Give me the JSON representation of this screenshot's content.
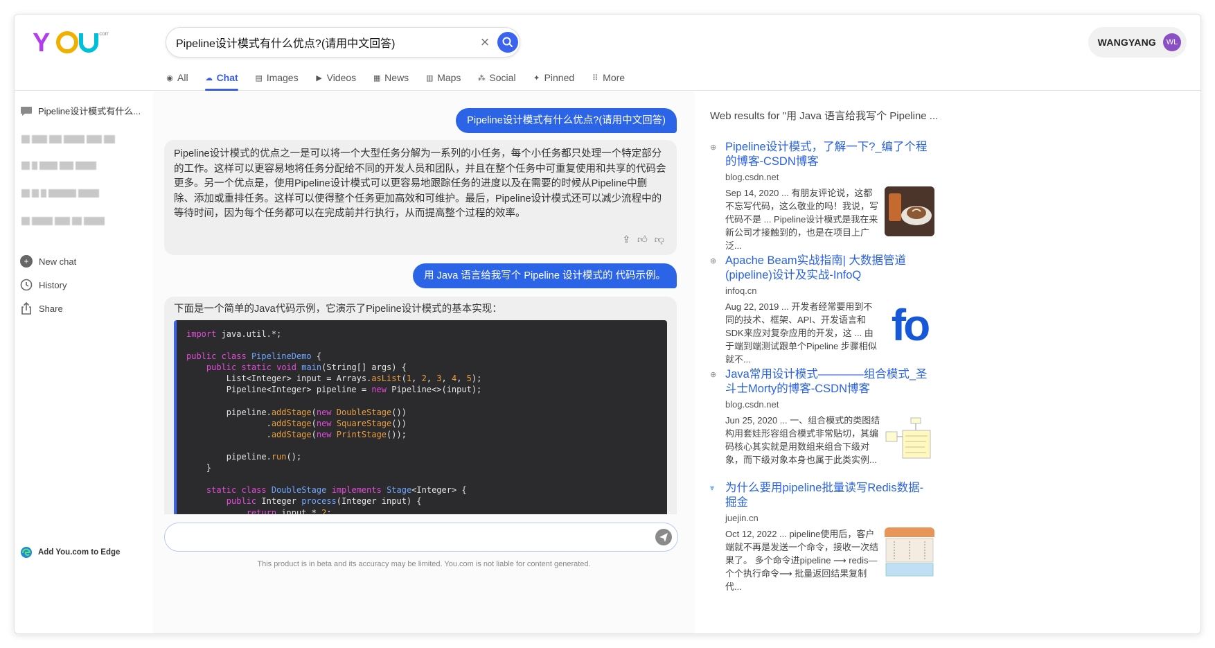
{
  "header": {
    "logo_text": "YOU",
    "logo_sub": ".com",
    "search_value": "Pipeline设计模式有什么优点?(请用中文回答)",
    "user_name": "WANGYANG",
    "user_initials": "WL"
  },
  "tabs": [
    {
      "label": "All",
      "icon": "search-circle-icon",
      "glyph": "◉"
    },
    {
      "label": "Chat",
      "icon": "chat-icon",
      "glyph": "☁"
    },
    {
      "label": "Images",
      "icon": "images-icon",
      "glyph": "▤"
    },
    {
      "label": "Videos",
      "icon": "play-icon",
      "glyph": "▶"
    },
    {
      "label": "News",
      "icon": "news-icon",
      "glyph": "▦"
    },
    {
      "label": "Maps",
      "icon": "map-icon",
      "glyph": "▥"
    },
    {
      "label": "Social",
      "icon": "people-icon",
      "glyph": "⁂"
    },
    {
      "label": "Pinned",
      "icon": "pin-icon",
      "glyph": "✦"
    },
    {
      "label": "More",
      "icon": "grid-dots-icon",
      "glyph": "⠿"
    }
  ],
  "sidebar": {
    "current_conversation": "Pipeline设计模式有什么...",
    "new_chat": "New chat",
    "history": "History",
    "share": "Share",
    "edge": "Add You.com to Edge"
  },
  "chat": {
    "q1": "Pipeline设计模式有什么优点?(请用中文回答)",
    "a1": "Pipeline设计模式的优点之一是可以将一个大型任务分解为一系列的小任务，每个小任务都只处理一个特定部分的工作。这样可以更容易地将任务分配给不同的开发人员和团队，并且在整个任务中可重复使用和共享的代码会更多。另一个优点是，使用Pipeline设计模式可以更容易地跟踪任务的进度以及在需要的时候从Pipeline中删除、添加或重排任务。这样可以使得整个任务更加高效和可维护。最后，Pipeline设计模式还可以减少流程中的等待时间，因为每个任务都可以在完成前并行执行，从而提高整个过程的效率。",
    "q2": "用 Java 语言给我写个 Pipeline 设计模式的 代码示例。",
    "a2_intro": "下面是一个简单的Java代码示例，它演示了Pipeline设计模式的基本实现：",
    "composer_placeholder": "",
    "disclaimer": "This product is in beta and its accuracy may be limited. You.com is not liable for content generated."
  },
  "code": {
    "import_kw": "import",
    "import_rest": " java.util.*;",
    "public": "public",
    "class": "class",
    "static": "static",
    "void": "void",
    "new": "new",
    "return": "return",
    "implements": "implements",
    "PipelineDemo": "PipelineDemo",
    "main": "main",
    "main_args": "(String[] args) {",
    "list_line": "List<Integer> input = Arrays.",
    "asList": "asList",
    "n1": "1",
    "n2": "2",
    "n3": "3",
    "n4": "4",
    "n5": "5",
    "pipeline_decl": "Pipeline<Integer> pipeline = ",
    "pipeline_ctor": " Pipeline<>(input);",
    "pipeline_dot": "pipeline.",
    "addStage": "addStage",
    "DoubleStage": "DoubleStage",
    "SquareStage": "SquareStage",
    "PrintStage": "PrintStage",
    "run": "run",
    "Stage": "Stage",
    "process": "process",
    "process_args": "(Integer input) {",
    "integer": "Integer",
    "return_expr": " input * ",
    "close_brace": "}"
  },
  "results": {
    "heading": "Web results for \"用 Java 语言给我写个 Pipeline ...",
    "items": [
      {
        "title": "Pipeline设计模式，了解一下?_编了个程的博客-CSDN博客",
        "domain": "blog.csdn.net",
        "snippet": "Sep 14, 2020 ... 有朋友评论说，这都不忘写代码，这么敬业的吗！我说，写代码不是 ... Pipeline设计模式是我在来新公司才接触到的，也是在项目上广泛...",
        "bullet_icon": "globe-icon",
        "thumb": "coffee-photo"
      },
      {
        "title": "Apache Beam实战指南| 大数据管道(pipeline)设计及实战-InfoQ",
        "domain": "infoq.cn",
        "snippet": "Aug 22, 2019 ... 开发者经常要用到不同的技术、框架、API、开发语言和SDK来应对复杂应用的开发，这 ... 由于端到端测试跟单个Pipeline 步骤相似就不...",
        "bullet_icon": "globe-icon",
        "thumb_text": "fo"
      },
      {
        "title": "Java常用设计模式————组合模式_圣斗士Morty的博客-CSDN博客",
        "domain": "blog.csdn.net",
        "snippet": "Jun 25, 2020 ... 一、组合模式的类图结构用套娃形容组合模式非常贴切，其编码核心其实就是用数组来组合下级对象，而下级对象本身也属于此类实例...",
        "bullet_icon": "globe-icon",
        "thumb": "uml-diagram"
      },
      {
        "title": "为什么要用pipeline批量读写Redis数据- 掘金",
        "domain": "juejin.cn",
        "snippet": "Oct 12, 2022 ... pipeline使用后，客户端就不再是发送一个命令，接收一次结果了。 多个命令进pipeline ⟶ redis—个个执行命令⟶ 批量返回结果复制代...",
        "bullet_icon": "juejin-icon",
        "thumb": "redis-diagram"
      }
    ]
  },
  "colors": {
    "accent": "#2c64e8",
    "tab_active": "#3a5de6",
    "link": "#2a62e2",
    "avatar": "#8a4fc4"
  }
}
